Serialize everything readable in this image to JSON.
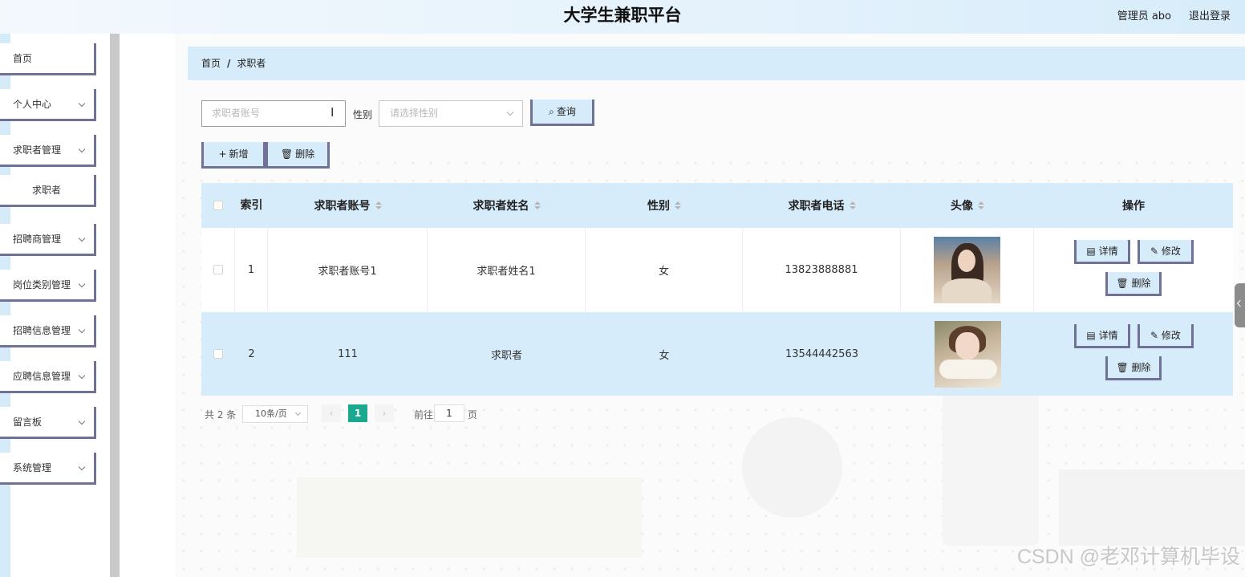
{
  "header": {
    "title": "大学生兼职平台",
    "user_label": "管理员 abo",
    "logout_label": "退出登录"
  },
  "sidebar": {
    "items": [
      {
        "label": "首页",
        "has_arrow": false
      },
      {
        "label": "个人中心",
        "has_arrow": true
      },
      {
        "label": "求职者管理",
        "has_arrow": true
      },
      {
        "label": "求职者",
        "has_arrow": false,
        "sub": true
      },
      {
        "label": "招聘商管理",
        "has_arrow": true
      },
      {
        "label": "岗位类别管理",
        "has_arrow": true
      },
      {
        "label": "招聘信息管理",
        "has_arrow": true
      },
      {
        "label": "应聘信息管理",
        "has_arrow": true
      },
      {
        "label": "留言板",
        "has_arrow": true
      },
      {
        "label": "系统管理",
        "has_arrow": true
      }
    ]
  },
  "breadcrumb": {
    "home": "首页",
    "separator": "/",
    "current": "求职者"
  },
  "filters": {
    "account_placeholder": "求职者账号",
    "gender_label": "性别",
    "gender_placeholder": "请选择性别",
    "query_label": "查询",
    "query_icon": "search-icon"
  },
  "actions": {
    "add_label": "新增",
    "add_icon": "plus-icon",
    "delete_label": "删除",
    "delete_icon": "trash-icon"
  },
  "table": {
    "columns": {
      "index": "索引",
      "account": "求职者账号",
      "name": "求职者姓名",
      "gender": "性别",
      "phone": "求职者电话",
      "avatar": "头像",
      "ops": "操作"
    },
    "rows": [
      {
        "index": "1",
        "account": "求职者账号1",
        "name": "求职者姓名1",
        "gender": "女",
        "phone": "13823888881",
        "avatar": "woman-portrait-photo"
      },
      {
        "index": "2",
        "account": "111",
        "name": "求职者",
        "gender": "女",
        "phone": "13544442563",
        "avatar": "woman-portrait-photo"
      }
    ],
    "row_actions": {
      "detail_label": "详情",
      "edit_label": "修改",
      "delete_label": "删除"
    }
  },
  "pagination": {
    "total_text": "共 2 条",
    "page_size": "10条/页",
    "current_page": "1",
    "goto_label": "前往",
    "goto_value": "1",
    "page_suffix": "页"
  },
  "watermark": "CSDN @老邓计算机毕设",
  "colors": {
    "accent_light": "#d7ecfa",
    "border_dark": "#6f7196",
    "page_active": "#1aa98f"
  }
}
